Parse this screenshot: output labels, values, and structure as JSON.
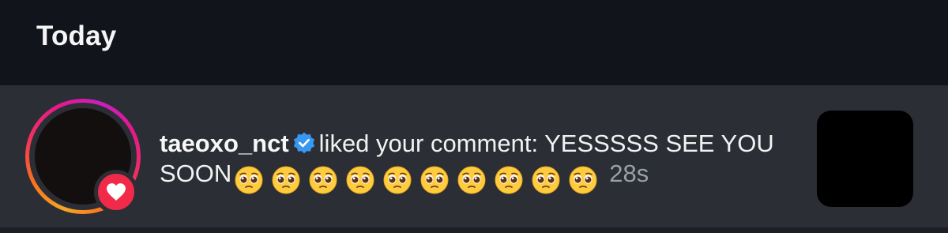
{
  "section": {
    "title": "Today"
  },
  "notification": {
    "username": "taeoxo_nct",
    "action_text": "liked your comment: YESSSSS SEE YOU SOON",
    "emojis": [
      "pleading-face",
      "pleading-face",
      "pleading-face",
      "pleading-face",
      "pleading-face",
      "pleading-face",
      "pleading-face",
      "pleading-face",
      "pleading-face",
      "pleading-face"
    ],
    "emoji_count": 10,
    "timestamp": "28s",
    "verified": true,
    "badge_icon": "heart-icon"
  },
  "colors": {
    "background": "#11141a",
    "row_background": "#2b2e35",
    "like_badge": "#f22a4a",
    "verified_blue": "#3897f0",
    "timestamp_gray": "#9aa0a8",
    "story_ring": [
      "#f5a623",
      "#f2305f",
      "#c81fc2"
    ]
  }
}
